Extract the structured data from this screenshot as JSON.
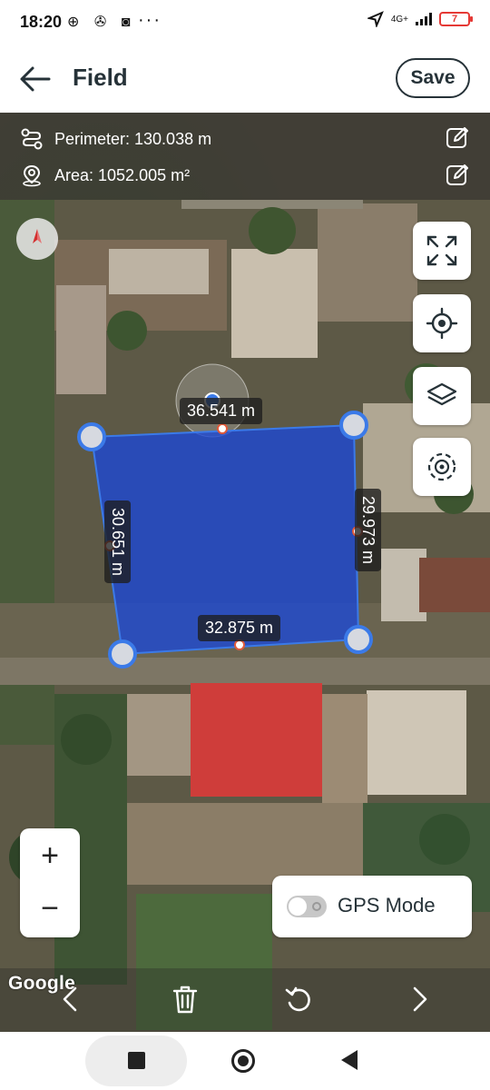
{
  "status_bar": {
    "time": "18:20",
    "left_icons": "⊕ ✇ ◙",
    "more": "···",
    "network": "4G+",
    "battery": "7"
  },
  "header": {
    "title": "Field",
    "save_label": "Save"
  },
  "info": {
    "perimeter": "Perimeter: 130.038 m",
    "area": "Area: 1052.005 m²"
  },
  "polygon": {
    "edges": {
      "top": "36.541 m",
      "left": "30.651 m",
      "right": "29.973 m",
      "bottom": "32.875 m"
    },
    "fill_color": "#1f4fd6",
    "vertex_color": "#d6d9e0",
    "accent": "#3b7ae8"
  },
  "controls": {
    "zoom_in": "+",
    "zoom_out": "−",
    "gps_mode": "GPS Mode",
    "gps_enabled": false
  },
  "map": {
    "attribution": "Google"
  },
  "toolbar": {
    "icons": [
      "chevron-left-icon",
      "trash-icon",
      "undo-icon",
      "chevron-right-icon"
    ]
  }
}
